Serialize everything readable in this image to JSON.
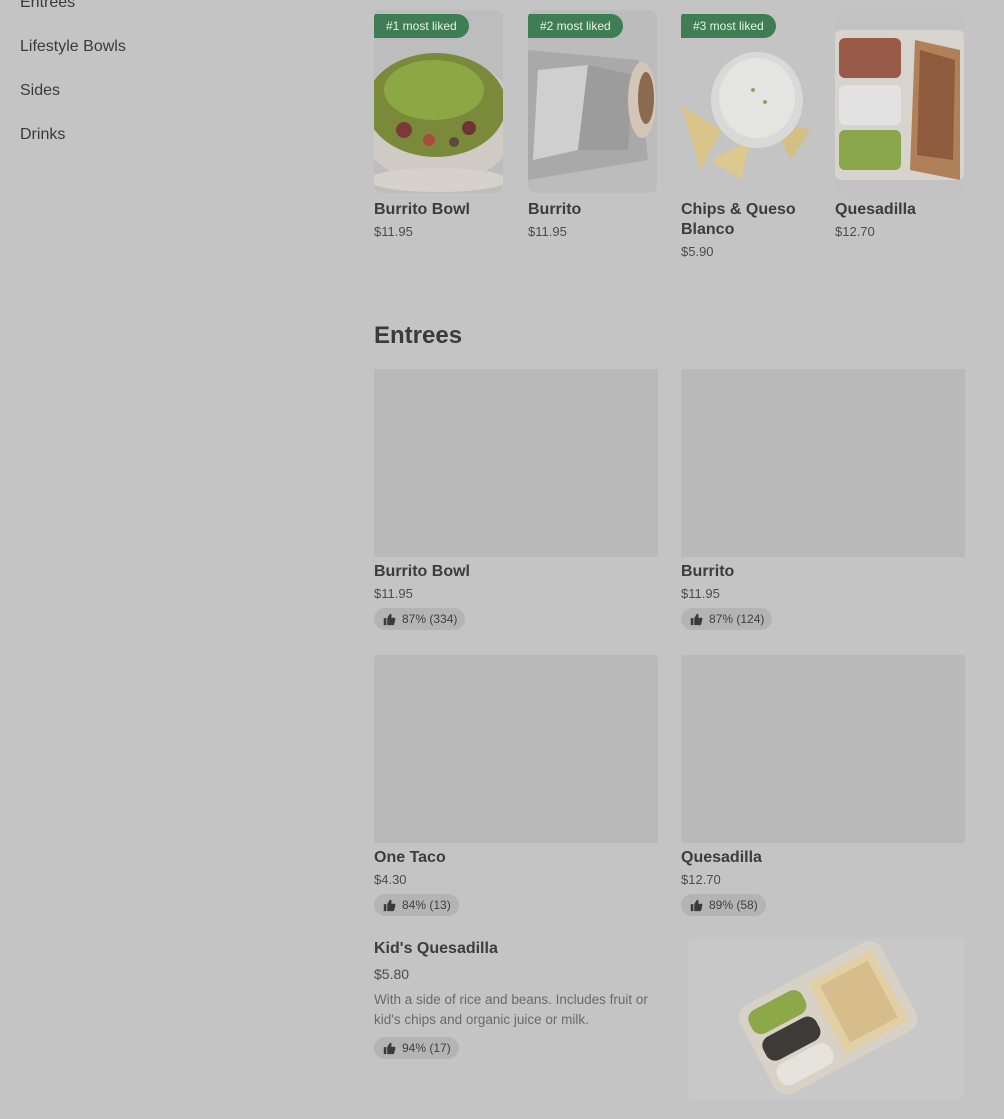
{
  "sidebar": {
    "items": [
      {
        "label": "Entrees"
      },
      {
        "label": "Lifestyle Bowls"
      },
      {
        "label": "Sides"
      },
      {
        "label": "Drinks"
      }
    ]
  },
  "most_liked": [
    {
      "badge": "#1 most liked",
      "name": "Burrito Bowl",
      "price": "$11.95"
    },
    {
      "badge": "#2 most liked",
      "name": "Burrito",
      "price": "$11.95"
    },
    {
      "badge": "#3 most liked",
      "name": "Chips & Queso Blanco",
      "price": "$5.90"
    },
    {
      "badge": "",
      "name": "Quesadilla",
      "price": "$12.70"
    }
  ],
  "entrees": {
    "title": "Entrees",
    "items": [
      {
        "name": "Burrito Bowl",
        "price": "$11.95",
        "rating": "87% (334)"
      },
      {
        "name": "Burrito",
        "price": "$11.95",
        "rating": "87% (124)"
      },
      {
        "name": "One Taco",
        "price": "$4.30",
        "rating": "84% (13)"
      },
      {
        "name": "Quesadilla",
        "price": "$12.70",
        "rating": "89% (58)"
      }
    ],
    "featured": {
      "name": "Kid's Quesadilla",
      "price": "$5.80",
      "description": "With a side of rice and beans. Includes fruit or kid's chips and organic juice or milk.",
      "rating": "94% (17)"
    }
  },
  "colors": {
    "badge_green": "#3f7d55",
    "overlay_bg": "#c4c4c4"
  },
  "icons": [
    "thumbs-up-icon"
  ]
}
